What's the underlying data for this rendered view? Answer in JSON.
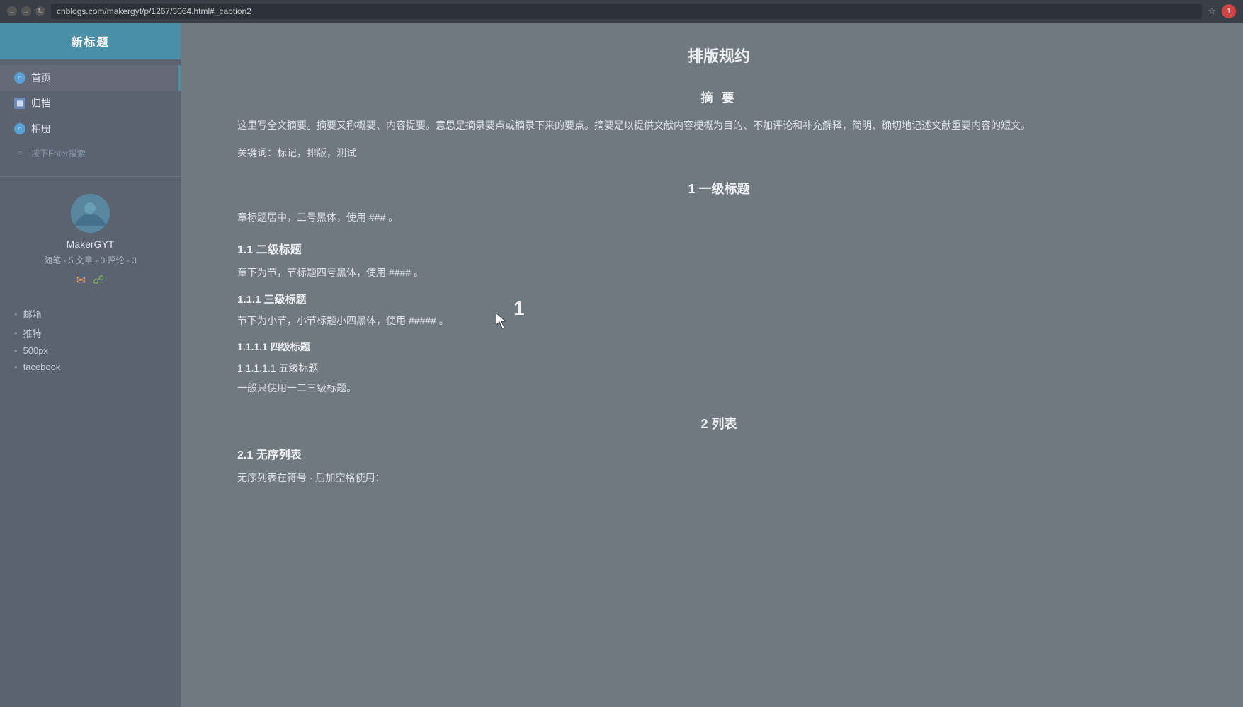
{
  "browser": {
    "url": "cnblogs.com/makergyt/p/1267/3064.html#_caption2",
    "back_btn": "←",
    "forward_btn": "→",
    "refresh_btn": "↻"
  },
  "sidebar": {
    "title": "新标题",
    "nav_items": [
      {
        "id": "home",
        "label": "首页",
        "icon_type": "home",
        "active": true
      },
      {
        "id": "archive",
        "label": "归档",
        "icon_type": "archive"
      },
      {
        "id": "album",
        "label": "相册",
        "icon_type": "album"
      },
      {
        "id": "search",
        "label": "按下Enter搜索",
        "icon_type": "search"
      }
    ],
    "user": {
      "name": "MakerGYT",
      "stats": "随笔 - 5  文章 - 0  评论 - 3"
    },
    "links": [
      {
        "label": "邮箱"
      },
      {
        "label": "推特"
      },
      {
        "label": "500px"
      },
      {
        "label": "facebook"
      }
    ]
  },
  "article": {
    "title": "排版规约",
    "abstract_heading": "摘 要",
    "abstract_text": "这里写全文摘要。摘要又称概要、内容提要。意思是摘录要点或摘录下来的要点。摘要是以提供文献内容梗概为目的、不加评论和补充解释，简明、确切地记述文献重要内容的短文。",
    "keywords": "关键词：标记，排版，测试",
    "h1_label": "1 一级标题",
    "h1_desc": "章标题居中，三号黑体，使用 ### 。",
    "h2_label": "1.1 二级标题",
    "h2_desc": "章下为节，节标题四号黑体，使用 #### 。",
    "h3_label": "1.1.1 三级标题",
    "h3_desc": "节下为小节，小节标题小四黑体，使用 ##### 。",
    "h4_label": "1.1.1.1 四级标题",
    "h5_label": "1.1.1.1.1 五级标题",
    "general_note": "一般只使用一二三级标题。",
    "section2_label": "2 列表",
    "section2_1_label": "2.1 无序列表",
    "section2_1_desc": "无序列表在符号 · 后加空格使用："
  }
}
